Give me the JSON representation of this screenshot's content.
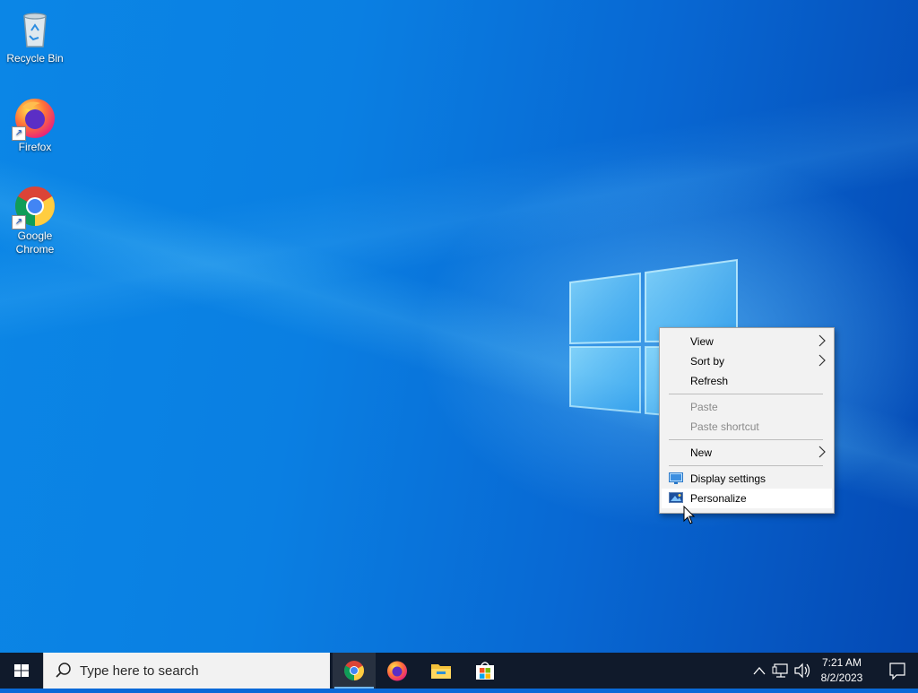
{
  "desktop": {
    "icons": [
      {
        "label": "Recycle Bin",
        "icon": "recycle-bin-icon"
      },
      {
        "label": "Firefox",
        "icon": "firefox-icon"
      },
      {
        "label": "Google Chrome",
        "icon": "chrome-icon"
      }
    ]
  },
  "context_menu": {
    "items": [
      {
        "label": "View",
        "has_submenu": true,
        "enabled": true
      },
      {
        "label": "Sort by",
        "has_submenu": true,
        "enabled": true
      },
      {
        "label": "Refresh",
        "enabled": true
      },
      {
        "label": "Paste",
        "enabled": false
      },
      {
        "label": "Paste shortcut",
        "enabled": false
      },
      {
        "label": "New",
        "has_submenu": true,
        "enabled": true
      },
      {
        "label": "Display settings",
        "icon": "display-icon",
        "enabled": true
      },
      {
        "label": "Personalize",
        "icon": "personalize-icon",
        "enabled": true,
        "highlighted": true
      }
    ]
  },
  "taskbar": {
    "search_placeholder": "Type here to search",
    "apps": [
      {
        "name": "Google Chrome",
        "icon": "chrome-icon",
        "active": true
      },
      {
        "name": "Firefox",
        "icon": "firefox-icon",
        "active": false
      },
      {
        "name": "File Explorer",
        "icon": "folder-icon",
        "active": false
      },
      {
        "name": "Microsoft Store",
        "icon": "store-icon",
        "active": false
      }
    ],
    "clock": {
      "time": "7:21 AM",
      "date": "8/2/2023"
    }
  },
  "colors": {
    "taskbar_bg": "#101a2b",
    "menu_bg": "#f2f2f2",
    "active_indicator": "#76b9ed",
    "wallpaper_blue": "#0a7fe2"
  }
}
